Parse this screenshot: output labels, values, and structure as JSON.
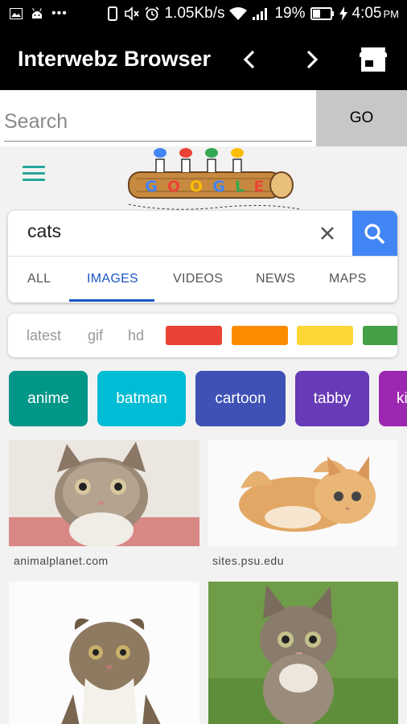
{
  "status_bar": {
    "speed": "1.05Kb/s",
    "battery": "19%",
    "time": "4:05",
    "ampm": "PM"
  },
  "app": {
    "title": "Interwebz Browser"
  },
  "url_bar": {
    "placeholder": "Search",
    "value": "",
    "go_label": "GO"
  },
  "google": {
    "query": "cats",
    "clear_icon": "close-icon",
    "tabs": [
      {
        "label": "ALL"
      },
      {
        "label": "IMAGES"
      },
      {
        "label": "VIDEOS"
      },
      {
        "label": "NEWS"
      },
      {
        "label": "MAPS"
      }
    ],
    "filters": {
      "words": [
        "latest",
        "gif",
        "hd"
      ],
      "colors": [
        "#ea4335",
        "#fb8c00",
        "#fdd835",
        "#43a047"
      ]
    },
    "chips": [
      {
        "label": "anime",
        "color": "#009688"
      },
      {
        "label": "batman",
        "color": "#00bcd4"
      },
      {
        "label": "cartoon",
        "color": "#3f51b5"
      },
      {
        "label": "tabby",
        "color": "#673ab7"
      },
      {
        "label": "ki",
        "color": "#9c27b0"
      }
    ],
    "results": [
      {
        "source": "animalplanet.com"
      },
      {
        "source": "sites.psu.edu"
      },
      {
        "source": ""
      },
      {
        "source": ""
      }
    ]
  }
}
